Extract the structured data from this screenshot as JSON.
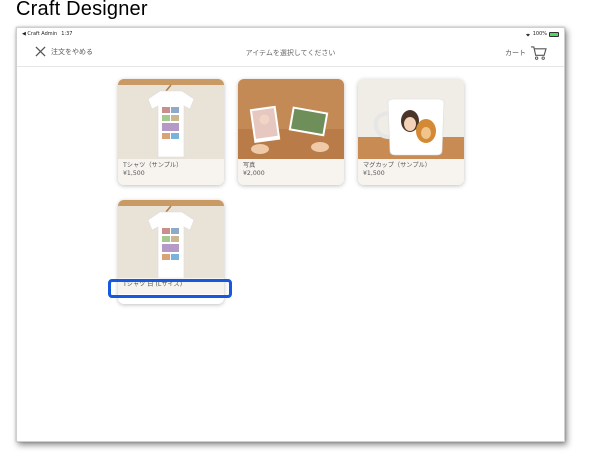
{
  "header": {
    "title": "Craft Designer"
  },
  "statusbar": {
    "back_label": "◀ Craft Admin",
    "time": "1:37",
    "battery": "100%"
  },
  "navbar": {
    "cancel_label": "注文をやめる",
    "title": "アイテムを選択してください",
    "cart_label": "カート"
  },
  "items": [
    {
      "name": "Tシャツ（サンプル）",
      "price": "¥1,500"
    },
    {
      "name": "写真",
      "price": "¥2,000"
    },
    {
      "name": "マグカップ（サンプル）",
      "price": "¥1,500"
    },
    {
      "name": "Tシャツ 白 (Lサイズ)",
      "price": ""
    }
  ],
  "colors": {
    "highlight": "#1659e0",
    "battery": "#4cd964",
    "caption_bg": "#f7f4ef"
  }
}
